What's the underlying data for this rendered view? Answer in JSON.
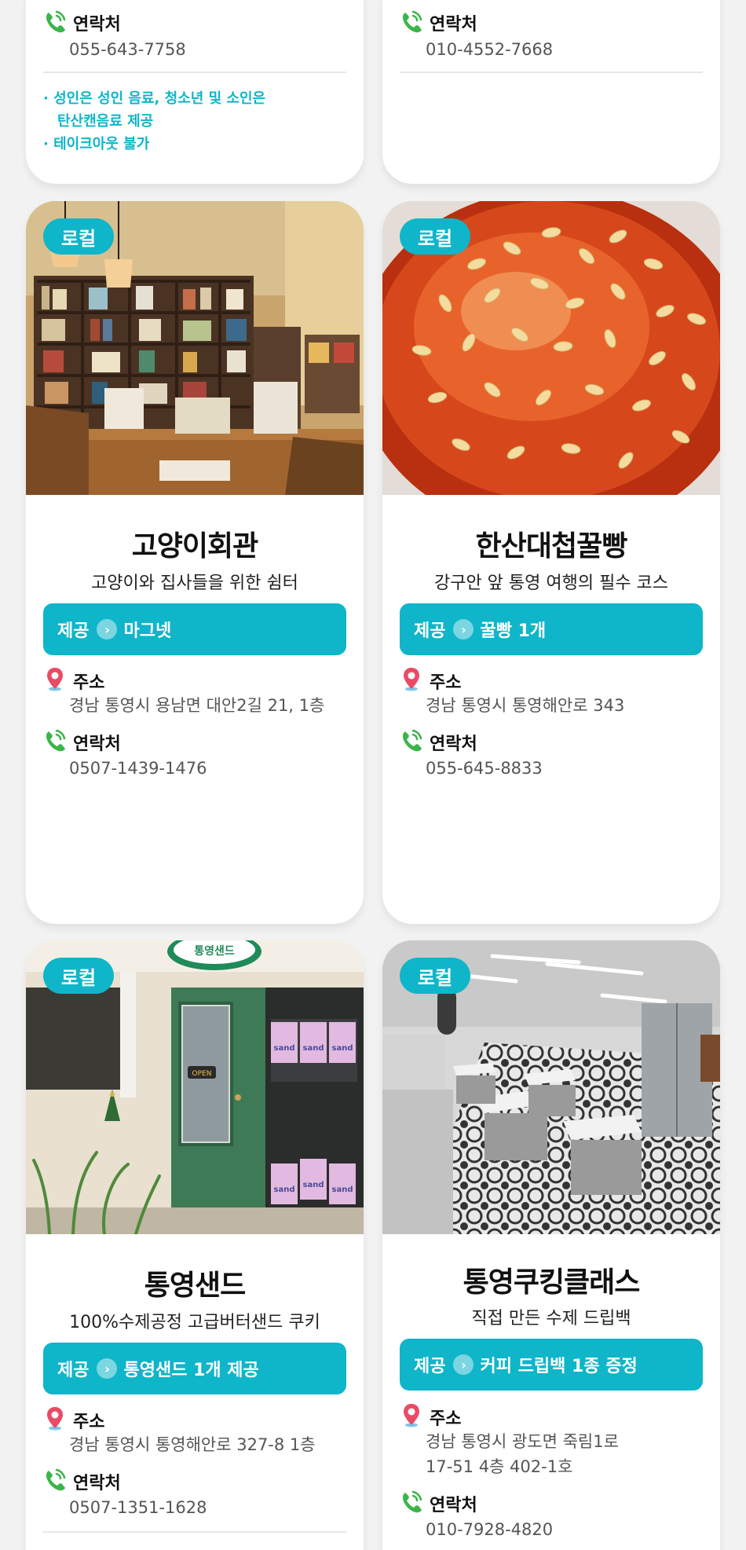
{
  "labels": {
    "address": "주소",
    "contact": "연락처",
    "offer": "제공"
  },
  "colors": {
    "accent": "#0fb5c9",
    "pin": "#e94b64",
    "phone": "#3bb54a"
  },
  "top_cards": [
    {
      "phone": "055-643-7758",
      "notes": [
        "· 성인은 성인 음료, 청소년 및 소인은",
        "탄산캔음료 제공",
        "· 테이크아웃 불가"
      ]
    },
    {
      "phone": "010-4552-7668"
    }
  ],
  "cards": [
    {
      "badge": "로컬",
      "title": "고양이회관",
      "subtitle": "고양이와 집사들을 위한 쉼터",
      "offer": "마그넷",
      "address": "경남 통영시 용남면 대안2길 21, 1층",
      "phone": "0507-1439-1476"
    },
    {
      "badge": "로컬",
      "title": "한산대첩꿀빵",
      "subtitle": "강구안 앞 통영 여행의 필수 코스",
      "offer": "꿀빵 1개",
      "address": "경남 통영시 통영해안로 343",
      "phone": "055-645-8833"
    },
    {
      "badge": "로컬",
      "title": "통영샌드",
      "subtitle": "100%수제공정 고급버터샌드 쿠키",
      "offer": "통영샌드 1개 제공",
      "address": "경남 통영시 통영해안로 327-8 1층",
      "phone": "0507-1351-1628",
      "image_text": {
        "sign": "통영샌드",
        "door": "OPEN",
        "sticker": "sand"
      }
    },
    {
      "badge": "로컬",
      "title": "통영쿠킹클래스",
      "subtitle": "직접 만든 수제 드립백",
      "offer": "커피 드립백 1종 증정",
      "address_lines": [
        "경남 통영시 광도면 죽림1로",
        "17-51 4층 402-1호"
      ],
      "phone": "010-7928-4820"
    }
  ],
  "icons": {
    "address": "map-pin-icon",
    "contact": "phone-icon",
    "offer_arrow": "chevron-right-icon"
  }
}
